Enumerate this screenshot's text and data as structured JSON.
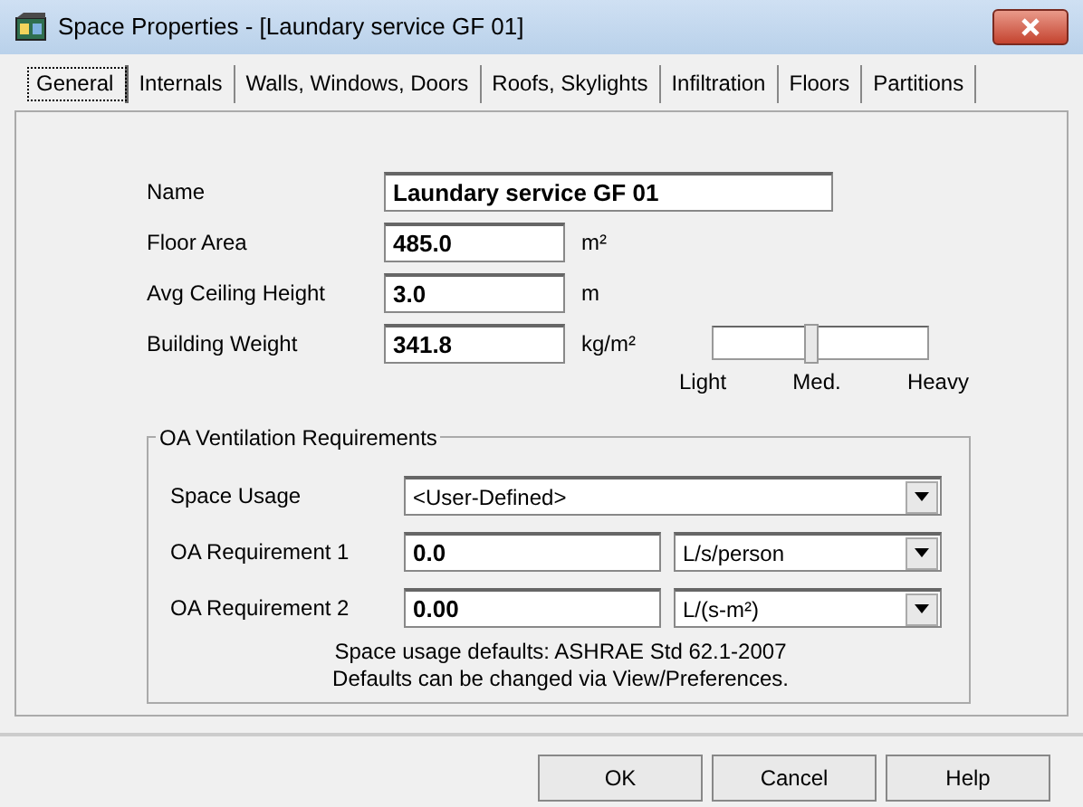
{
  "window": {
    "title": "Space Properties - [Laundary service GF 01]"
  },
  "tabs": [
    {
      "label": "General",
      "selected": true
    },
    {
      "label": "Internals",
      "selected": false
    },
    {
      "label": "Walls, Windows, Doors",
      "selected": false
    },
    {
      "label": "Roofs, Skylights",
      "selected": false
    },
    {
      "label": "Infiltration",
      "selected": false
    },
    {
      "label": "Floors",
      "selected": false
    },
    {
      "label": "Partitions",
      "selected": false
    }
  ],
  "fields": [
    {
      "label": "Name",
      "value": "Laundary service GF 01",
      "kind": "wide"
    },
    {
      "label": "Floor Area",
      "value": "485.0",
      "unit": "m²",
      "kind": "short"
    },
    {
      "label": "Avg Ceiling Height",
      "value": "3.0",
      "unit": "m",
      "kind": "short"
    },
    {
      "label": "Building Weight",
      "value": "341.8",
      "unit": "kg/m²",
      "kind": "short"
    }
  ],
  "weight_slider": {
    "level": 0.46,
    "ticks": [
      "Light",
      "Med.",
      "Heavy"
    ]
  },
  "ventilation": {
    "title": "OA Ventilation Requirements",
    "space_usage": {
      "label": "Space Usage",
      "value": "<User-Defined>"
    },
    "requirements": [
      {
        "label": "OA Requirement 1",
        "value": "0.0",
        "unit": "L/s/person"
      },
      {
        "label": "OA Requirement 2",
        "value": "0.00",
        "unit": "L/(s-m²)"
      }
    ],
    "notes": [
      "Space usage defaults: ASHRAE Std 62.1-2007",
      "Defaults can be changed via View/Preferences."
    ]
  },
  "buttons": [
    {
      "label": "OK"
    },
    {
      "label": "Cancel"
    },
    {
      "label": "Help"
    }
  ]
}
